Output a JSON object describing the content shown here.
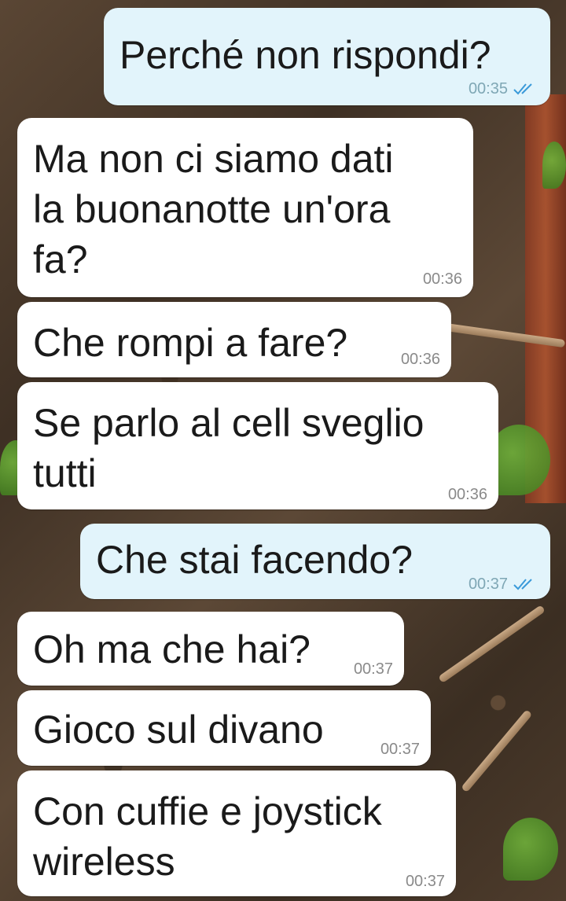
{
  "colors": {
    "outgoing_bubble": "#e2f4fb",
    "incoming_bubble": "#ffffff",
    "read_ticks": "#3a9ad9"
  },
  "messages": [
    {
      "direction": "outgoing",
      "text": "Perché non rispondi?",
      "time": "00:35",
      "status_icon": "double-check-icon"
    },
    {
      "direction": "incoming",
      "text": "Ma non ci siamo dati\nla buonanotte un'ora\nfa?",
      "time": "00:36"
    },
    {
      "direction": "incoming",
      "text": "Che rompi a fare?",
      "time": "00:36"
    },
    {
      "direction": "incoming",
      "text": "Se parlo al cell sveglio\ntutti",
      "time": "00:36"
    },
    {
      "direction": "outgoing",
      "text": "Che stai facendo?",
      "time": "00:37",
      "status_icon": "double-check-icon"
    },
    {
      "direction": "incoming",
      "text": "Oh ma che hai?",
      "time": "00:37"
    },
    {
      "direction": "incoming",
      "text": "Gioco sul divano",
      "time": "00:37"
    },
    {
      "direction": "incoming",
      "text": "Con cuffie e joystick\nwireless",
      "time": "00:37"
    }
  ]
}
